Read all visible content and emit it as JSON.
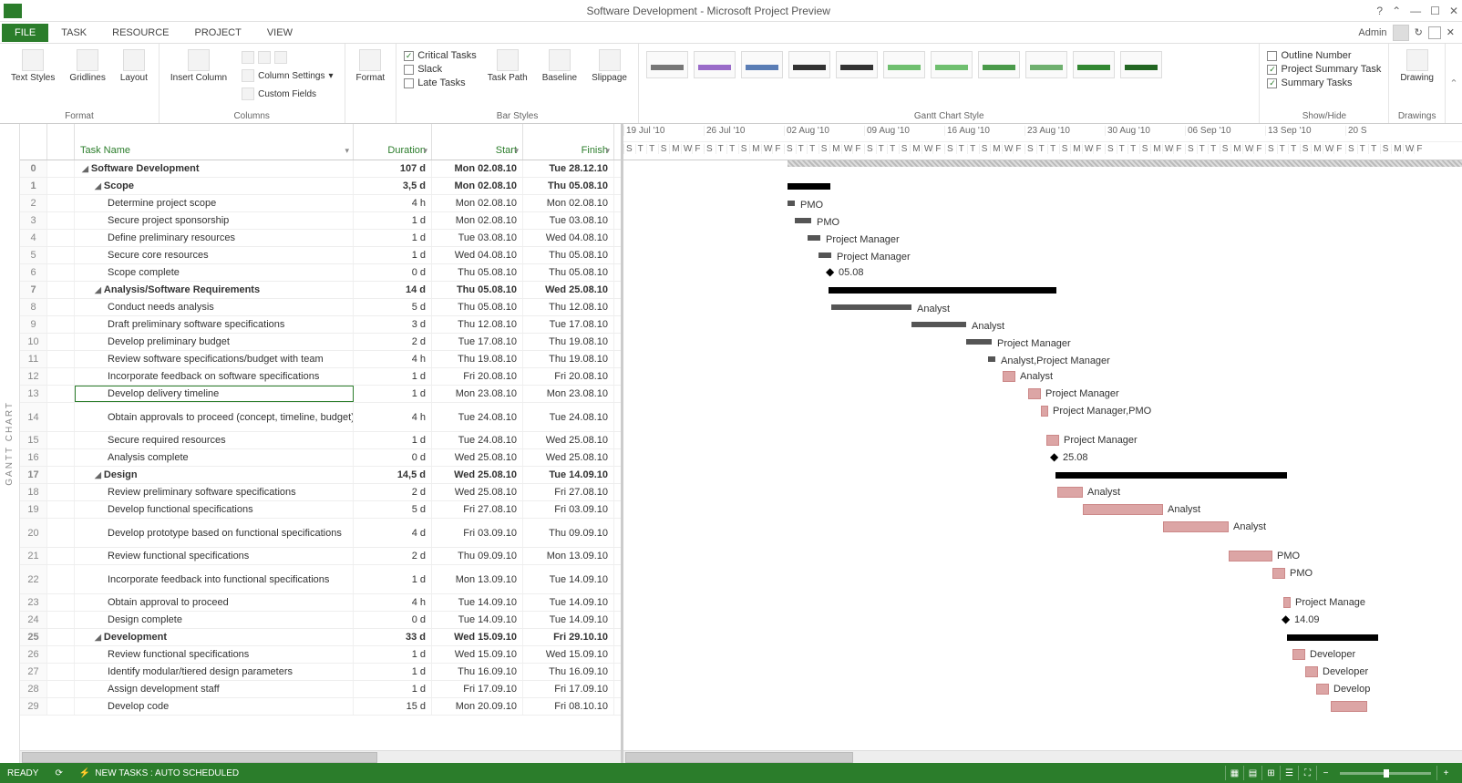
{
  "titlebar": {
    "title": "Software Development - Microsoft Project Preview"
  },
  "menutabs": {
    "file": "FILE",
    "task": "TASK",
    "resource": "RESOURCE",
    "project": "PROJECT",
    "view": "VIEW",
    "user": "Admin"
  },
  "ribbon": {
    "format": {
      "textStyles": "Text\nStyles",
      "gridlines": "Gridlines",
      "layout": "Layout",
      "label": "Format"
    },
    "columns": {
      "insertColumn": "Insert\nColumn",
      "columnSettings": "Column Settings",
      "customFields": "Custom Fields",
      "label": "Columns"
    },
    "format2": {
      "format": "Format",
      "label": ""
    },
    "barStyles": {
      "critical": "Critical Tasks",
      "slack": "Slack",
      "late": "Late Tasks",
      "taskPath": "Task\nPath",
      "baseline": "Baseline",
      "slippage": "Slippage",
      "label": "Bar Styles"
    },
    "ganttStyle": {
      "label": "Gantt Chart Style"
    },
    "showHide": {
      "outlineNumber": "Outline Number",
      "projectSummary": "Project Summary Task",
      "summaryTasks": "Summary Tasks",
      "label": "Show/Hide"
    },
    "drawings": {
      "drawing": "Drawing",
      "label": "Drawings"
    }
  },
  "gridHeader": {
    "taskName": "Task Name",
    "duration": "Duration",
    "start": "Start",
    "finish": "Finish"
  },
  "timeline": {
    "weeks": [
      "19 Jul '10",
      "26 Jul '10",
      "02 Aug '10",
      "09 Aug '10",
      "16 Aug '10",
      "23 Aug '10",
      "30 Aug '10",
      "06 Sep '10",
      "13 Sep '10",
      "20 S"
    ],
    "dayPattern": [
      "S",
      "T",
      "T",
      "S",
      "M",
      "W",
      "F"
    ]
  },
  "tasks": [
    {
      "id": 0,
      "level": 0,
      "summary": true,
      "name": "Software Development",
      "dur": "107 d",
      "start": "Mon 02.08.10",
      "finish": "Tue 28.12.10",
      "barStart": 180,
      "barLen": 640,
      "barType": "progress"
    },
    {
      "id": 1,
      "level": 1,
      "summary": true,
      "name": "Scope",
      "dur": "3,5 d",
      "start": "Mon 02.08.10",
      "finish": "Thu 05.08.10",
      "barStart": 180,
      "barLen": 47,
      "barType": "summary"
    },
    {
      "id": 2,
      "level": 2,
      "name": "Determine project scope",
      "dur": "4 h",
      "start": "Mon 02.08.10",
      "finish": "Mon 02.08.10",
      "barStart": 180,
      "barLen": 8,
      "barType": "task",
      "resource": "PMO"
    },
    {
      "id": 3,
      "level": 2,
      "name": "Secure project sponsorship",
      "dur": "1 d",
      "start": "Mon 02.08.10",
      "finish": "Tue 03.08.10",
      "barStart": 188,
      "barLen": 18,
      "barType": "task",
      "resource": "PMO"
    },
    {
      "id": 4,
      "level": 2,
      "name": "Define preliminary resources",
      "dur": "1 d",
      "start": "Tue 03.08.10",
      "finish": "Wed 04.08.10",
      "barStart": 202,
      "barLen": 14,
      "barType": "task",
      "resource": "Project Manager"
    },
    {
      "id": 5,
      "level": 2,
      "name": "Secure core resources",
      "dur": "1 d",
      "start": "Wed 04.08.10",
      "finish": "Thu 05.08.10",
      "barStart": 214,
      "barLen": 14,
      "barType": "task",
      "resource": "Project Manager"
    },
    {
      "id": 6,
      "level": 2,
      "name": "Scope complete",
      "dur": "0 d",
      "start": "Thu 05.08.10",
      "finish": "Thu 05.08.10",
      "barStart": 228,
      "barLen": 0,
      "barType": "milestone",
      "resource": "05.08"
    },
    {
      "id": 7,
      "level": 1,
      "summary": true,
      "name": "Analysis/Software Requirements",
      "dur": "14 d",
      "start": "Thu 05.08.10",
      "finish": "Wed 25.08.10",
      "barStart": 225,
      "barLen": 250,
      "barType": "summary"
    },
    {
      "id": 8,
      "level": 2,
      "name": "Conduct needs analysis",
      "dur": "5 d",
      "start": "Thu 05.08.10",
      "finish": "Thu 12.08.10",
      "barStart": 228,
      "barLen": 88,
      "barType": "task",
      "resource": "Analyst"
    },
    {
      "id": 9,
      "level": 2,
      "name": "Draft preliminary software specifications",
      "dur": "3 d",
      "start": "Thu 12.08.10",
      "finish": "Tue 17.08.10",
      "barStart": 316,
      "barLen": 60,
      "barType": "task",
      "resource": "Analyst"
    },
    {
      "id": 10,
      "level": 2,
      "name": "Develop preliminary budget",
      "dur": "2 d",
      "start": "Tue 17.08.10",
      "finish": "Thu 19.08.10",
      "barStart": 376,
      "barLen": 28,
      "barType": "task",
      "resource": "Project Manager"
    },
    {
      "id": 11,
      "level": 2,
      "name": "Review software specifications/budget with team",
      "dur": "4 h",
      "start": "Thu 19.08.10",
      "finish": "Thu 19.08.10",
      "barStart": 400,
      "barLen": 8,
      "barType": "task",
      "resource": "Analyst,Project Manager"
    },
    {
      "id": 12,
      "level": 2,
      "name": "Incorporate feedback on software specifications",
      "dur": "1 d",
      "start": "Fri 20.08.10",
      "finish": "Fri 20.08.10",
      "barStart": 416,
      "barLen": 14,
      "barType": "ctask",
      "resource": "Analyst"
    },
    {
      "id": 13,
      "level": 2,
      "selected": true,
      "name": "Develop delivery timeline",
      "dur": "1 d",
      "start": "Mon 23.08.10",
      "finish": "Mon 23.08.10",
      "barStart": 444,
      "barLen": 14,
      "barType": "ctask",
      "resource": "Project Manager"
    },
    {
      "id": 14,
      "level": 2,
      "tall": true,
      "name": "Obtain approvals to proceed (concept, timeline, budget)",
      "dur": "4 h",
      "start": "Tue 24.08.10",
      "finish": "Tue 24.08.10",
      "barStart": 458,
      "barLen": 8,
      "barType": "ctask",
      "resource": "Project Manager,PMO"
    },
    {
      "id": 15,
      "level": 2,
      "name": "Secure required resources",
      "dur": "1 d",
      "start": "Tue 24.08.10",
      "finish": "Wed 25.08.10",
      "barStart": 464,
      "barLen": 14,
      "barType": "ctask",
      "resource": "Project Manager"
    },
    {
      "id": 16,
      "level": 2,
      "name": "Analysis complete",
      "dur": "0 d",
      "start": "Wed 25.08.10",
      "finish": "Wed 25.08.10",
      "barStart": 474,
      "barLen": 0,
      "barType": "milestone",
      "resource": "25.08"
    },
    {
      "id": 17,
      "level": 1,
      "summary": true,
      "name": "Design",
      "dur": "14,5 d",
      "start": "Wed 25.08.10",
      "finish": "Tue 14.09.10",
      "barStart": 474,
      "barLen": 254,
      "barType": "summary"
    },
    {
      "id": 18,
      "level": 2,
      "name": "Review preliminary software specifications",
      "dur": "2 d",
      "start": "Wed 25.08.10",
      "finish": "Fri 27.08.10",
      "barStart": 476,
      "barLen": 28,
      "barType": "ctask",
      "resource": "Analyst"
    },
    {
      "id": 19,
      "level": 2,
      "name": "Develop functional specifications",
      "dur": "5 d",
      "start": "Fri 27.08.10",
      "finish": "Fri 03.09.10",
      "barStart": 504,
      "barLen": 88,
      "barType": "ctask",
      "resource": "Analyst"
    },
    {
      "id": 20,
      "level": 2,
      "tall": true,
      "name": "Develop prototype based on functional specifications",
      "dur": "4 d",
      "start": "Fri 03.09.10",
      "finish": "Thu 09.09.10",
      "barStart": 592,
      "barLen": 72,
      "barType": "ctask",
      "resource": "Analyst"
    },
    {
      "id": 21,
      "level": 2,
      "name": "Review functional specifications",
      "dur": "2 d",
      "start": "Thu 09.09.10",
      "finish": "Mon 13.09.10",
      "barStart": 664,
      "barLen": 48,
      "barType": "ctask",
      "resource": "PMO"
    },
    {
      "id": 22,
      "level": 2,
      "tall": true,
      "name": "Incorporate feedback into functional specifications",
      "dur": "1 d",
      "start": "Mon 13.09.10",
      "finish": "Tue 14.09.10",
      "barStart": 712,
      "barLen": 14,
      "barType": "ctask",
      "resource": "PMO"
    },
    {
      "id": 23,
      "level": 2,
      "name": "Obtain approval to proceed",
      "dur": "4 h",
      "start": "Tue 14.09.10",
      "finish": "Tue 14.09.10",
      "barStart": 724,
      "barLen": 8,
      "barType": "ctask",
      "resource": "Project Manage"
    },
    {
      "id": 24,
      "level": 2,
      "name": "Design complete",
      "dur": "0 d",
      "start": "Tue 14.09.10",
      "finish": "Tue 14.09.10",
      "barStart": 728,
      "barLen": 0,
      "barType": "milestone",
      "resource": "14.09"
    },
    {
      "id": 25,
      "level": 1,
      "summary": true,
      "name": "Development",
      "dur": "33 d",
      "start": "Wed 15.09.10",
      "finish": "Fri 29.10.10",
      "barStart": 728,
      "barLen": 100,
      "barType": "summary"
    },
    {
      "id": 26,
      "level": 2,
      "name": "Review functional specifications",
      "dur": "1 d",
      "start": "Wed 15.09.10",
      "finish": "Wed 15.09.10",
      "barStart": 734,
      "barLen": 14,
      "barType": "ctask",
      "resource": "Developer"
    },
    {
      "id": 27,
      "level": 2,
      "name": "Identify modular/tiered design parameters",
      "dur": "1 d",
      "start": "Thu 16.09.10",
      "finish": "Thu 16.09.10",
      "barStart": 748,
      "barLen": 14,
      "barType": "ctask",
      "resource": "Developer"
    },
    {
      "id": 28,
      "level": 2,
      "name": "Assign development staff",
      "dur": "1 d",
      "start": "Fri 17.09.10",
      "finish": "Fri 17.09.10",
      "barStart": 760,
      "barLen": 14,
      "barType": "ctask",
      "resource": "Develop"
    },
    {
      "id": 29,
      "level": 2,
      "name": "Develop code",
      "dur": "15 d",
      "start": "Mon 20.09.10",
      "finish": "Fri 08.10.10",
      "barStart": 776,
      "barLen": 40,
      "barType": "ctask",
      "resource": ""
    }
  ],
  "sideLabel": "GANTT CHART",
  "statusbar": {
    "ready": "READY",
    "newTasks": "NEW TASKS : AUTO SCHEDULED"
  },
  "styleColors": [
    "#777",
    "#9a6cc9",
    "#5a7db5",
    "#333",
    "#333",
    "#6fbf6f",
    "#6fbf6f",
    "#4a9a4a",
    "#6fb06f",
    "#338833",
    "#226622"
  ]
}
